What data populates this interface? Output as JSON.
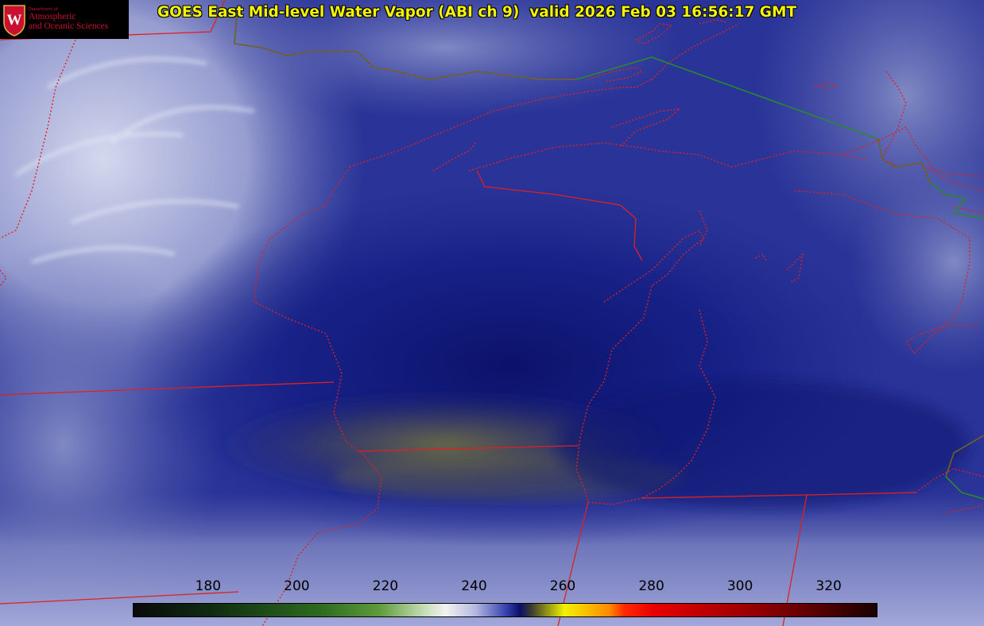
{
  "header": {
    "title": "GOES East Mid-level Water Vapor (ABI ch 9)  valid 2026 Feb 03 16:56:17 GMT"
  },
  "logo": {
    "seal_letter": "W",
    "dept_label": "Department of",
    "line1": "Atmospheric",
    "line2": "and Oceanic Sciences"
  },
  "colorbar": {
    "ticks": [
      {
        "label": "180",
        "value": 180
      },
      {
        "label": "200",
        "value": 200
      },
      {
        "label": "220",
        "value": 220
      },
      {
        "label": "240",
        "value": 240
      },
      {
        "label": "260",
        "value": 260
      },
      {
        "label": "280",
        "value": 280
      },
      {
        "label": "300",
        "value": 300
      },
      {
        "label": "320",
        "value": 320
      }
    ],
    "range": [
      163,
      331
    ]
  },
  "colors": {
    "state_borders": "#e02020",
    "coastline": "#2a8a2a",
    "title_text": "#f4f400",
    "logo_red": "#c9102e"
  }
}
